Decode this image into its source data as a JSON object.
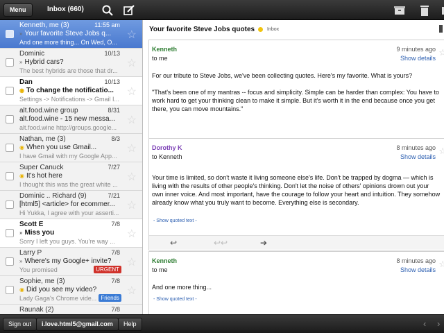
{
  "topbar": {
    "menu_label": "Menu",
    "inbox_label": "Inbox (660)",
    "icons": [
      "search-icon",
      "compose-icon",
      "archive-icon",
      "trash-icon",
      "more-icon"
    ]
  },
  "list": [
    {
      "sender": "Kenneth, me (3)",
      "date": "11:55 am",
      "subject": "Your favorite Steve Jobs q...",
      "snippet": "And one more thing... On Wed, O...",
      "state": "selected",
      "marker": "»"
    },
    {
      "sender": "Dominic",
      "date": "10/13",
      "subject": "Hybrid cars?",
      "snippet": "The best hybrids are those that dr...",
      "state": "read",
      "marker": "»"
    },
    {
      "sender": "Dan",
      "date": "10/13",
      "subject": "To change the notificatio...",
      "snippet": "Settings -> Notifications -> Gmail I...",
      "state": "unread",
      "marker": "●"
    },
    {
      "sender": "alt.food.wine group",
      "date": "8/31",
      "subject": "alt.food.wine - 15 new messa...",
      "snippet": "alt.food.wine http://groups.google...",
      "state": "read",
      "marker": ""
    },
    {
      "sender": "Nathan, me (3)",
      "date": "8/3",
      "subject": "When you use Gmail...",
      "snippet": "I have Gmail with my Google App...",
      "state": "read",
      "marker": "●"
    },
    {
      "sender": "Super Canuck",
      "date": "7/27",
      "subject": "It's hot here",
      "snippet": "I thought this was the great white ...",
      "state": "read",
      "marker": "●"
    },
    {
      "sender": "Dominic .. Richard (9)",
      "date": "7/21",
      "subject": "[html5] <article> for ecommer...",
      "snippet": "Hi Yukka, I agree with your asserti...",
      "state": "read",
      "marker": ""
    },
    {
      "sender": "Scott E",
      "date": "7/8",
      "subject": "Miss you",
      "snippet": "Sorry I left you guys. You're way ...",
      "state": "unread",
      "marker": "»"
    },
    {
      "sender": "Larry P",
      "date": "7/8",
      "subject": "Where's my Google+ invite?",
      "snippet": "You promised",
      "state": "read",
      "marker": "»",
      "tag": "URGENT",
      "tag_color": "#d0322b"
    },
    {
      "sender": "Sophie, me (3)",
      "date": "7/8",
      "subject": "Did you see my video?",
      "snippet": "Lady Gaga's Chrome vide...",
      "state": "read",
      "marker": "●",
      "tag": "Friends",
      "tag_color": "#3a7bd5"
    },
    {
      "sender": "Raunak (2)",
      "date": "7/8",
      "subject": "",
      "snippet": "",
      "state": "read",
      "marker": ""
    }
  ],
  "conversation": {
    "title": "Your favorite Steve Jobs quotes",
    "label": "Inbox",
    "messages": [
      {
        "from": "Kenneth",
        "from_color": "#2e7d32",
        "to": "to me",
        "time": "9 minutes ago",
        "details": "Show details",
        "body1": "For our tribute to Steve Jobs, we've been collecting quotes. Here's my favorite. What is yours?",
        "body2": "\"That's been one of my mantras -- focus and simplicity. Simple can be harder than complex: You have to work hard to get your thinking clean to make it simple. But it's worth it in the end because once you get there, you can move mountains.\""
      },
      {
        "from": "Dorothy K",
        "from_color": "#7b3fb5",
        "to": "to Kenneth",
        "time": "8 minutes ago",
        "details": "Show details",
        "body1": "Your time is limited, so don't waste it living someone else's life. Don't be trapped by dogma — which is living with the results of other people's thinking. Don't let the noise of others' opinions drown out your own inner voice. And most important, have the courage to follow your heart and intuition. They somehow already know what you truly want to become. Everything else is secondary.",
        "quoted": "- Show quoted text -"
      },
      {
        "from": "Kenneth",
        "from_color": "#2e7d32",
        "to": "to me",
        "time": "8 minutes ago",
        "details": "Show details",
        "body1": "And one more thing...",
        "quoted": "- Show quoted text -"
      }
    ]
  },
  "bottombar": {
    "signout": "Sign out",
    "email": "i.love.html5@gmail.com",
    "help": "Help"
  }
}
